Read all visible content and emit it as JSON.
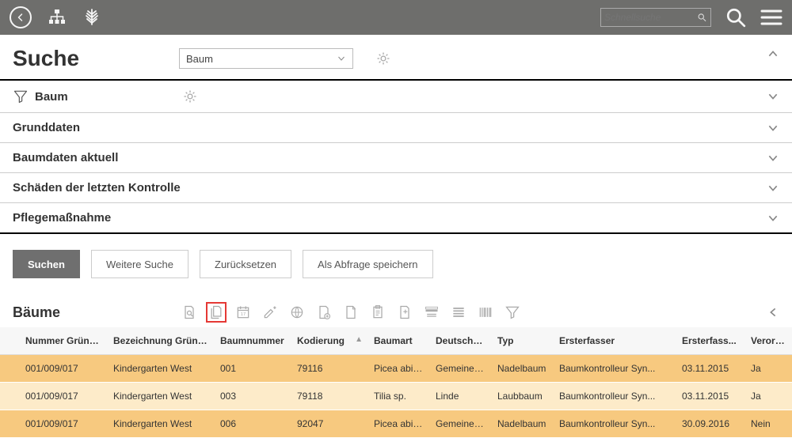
{
  "quicksearch_placeholder": "Schnellsuche",
  "search": {
    "title": "Suche",
    "type_value": "Baum"
  },
  "sections": {
    "filter_row": {
      "label": "Baum"
    },
    "rows": [
      {
        "label": "Grunddaten"
      },
      {
        "label": "Baumdaten aktuell"
      },
      {
        "label": "Schäden der letzten Kontrolle"
      },
      {
        "label": "Pflegemaßnahme"
      }
    ]
  },
  "buttons": {
    "search": "Suchen",
    "more": "Weitere Suche",
    "reset": "Zurücksetzen",
    "save_query": "Als Abfrage speichern"
  },
  "results": {
    "title": "Bäume"
  },
  "table": {
    "headers": {
      "nummer": "Nummer Grünanlage",
      "bezeichnung": "Bezeichnung Grünan...",
      "baumnummer": "Baumnummer",
      "kodierung": "Kodierung",
      "baumart": "Baumart",
      "deutscher": "Deutscher ...",
      "typ": "Typ",
      "ersterfasser": "Ersterfasser",
      "ersterfass": "Ersterfass...",
      "verortet": "Verortet"
    },
    "rows": [
      {
        "nummer": "001/009/017",
        "bez": "Kindergarten West",
        "bnum": "001",
        "kod": "79116",
        "art": "Picea abies",
        "dn": "Gemeine F...",
        "typ": "Nadelbaum",
        "erf": "Baumkontrolleur Syn...",
        "date": "03.11.2015",
        "ver": "Ja",
        "cls": "sel"
      },
      {
        "nummer": "001/009/017",
        "bez": "Kindergarten West",
        "bnum": "003",
        "kod": "79118",
        "art": "Tilia sp.",
        "dn": "Linde",
        "typ": "Laubbaum",
        "erf": "Baumkontrolleur Syn...",
        "date": "03.11.2015",
        "ver": "Ja",
        "cls": "odd"
      },
      {
        "nummer": "001/009/017",
        "bez": "Kindergarten West",
        "bnum": "006",
        "kod": "92047",
        "art": "Picea abies",
        "dn": "Gemeine F...",
        "typ": "Nadelbaum",
        "erf": "Baumkontrolleur Syn...",
        "date": "30.09.2016",
        "ver": "Nein",
        "cls": "sel"
      }
    ]
  }
}
